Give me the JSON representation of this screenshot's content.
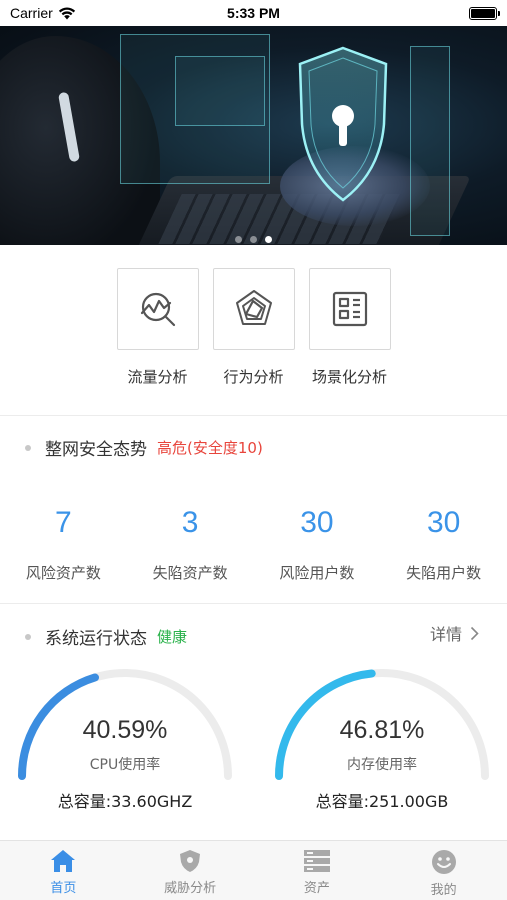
{
  "status_bar": {
    "carrier": "Carrier",
    "time": "5:33 PM"
  },
  "banner": {
    "slide_count": 3,
    "active_slide": 3
  },
  "quick_actions": [
    {
      "label": "流量分析",
      "icon": "traffic-analysis-icon"
    },
    {
      "label": "行为分析",
      "icon": "behavior-analysis-icon"
    },
    {
      "label": "场景化分析",
      "icon": "scenario-analysis-icon"
    }
  ],
  "security": {
    "title": "整网安全态势",
    "status": "高危(安全度10)",
    "status_color": "#e8453c",
    "stats": [
      {
        "value": "7",
        "label": "风险资产数"
      },
      {
        "value": "3",
        "label": "失陷资产数"
      },
      {
        "value": "30",
        "label": "风险用户数"
      },
      {
        "value": "30",
        "label": "失陷用户数"
      }
    ]
  },
  "system": {
    "title": "系统运行状态",
    "status": "健康",
    "status_color": "#2ab24b",
    "detail_label": "详情",
    "gauges": [
      {
        "value": "40.59%",
        "percent": 40.59,
        "label": "CPU使用率",
        "total": "总容量:33.60GHZ",
        "color": "#3b8de0"
      },
      {
        "value": "46.81%",
        "percent": 46.81,
        "label": "内存使用率",
        "total": "总容量:251.00GB",
        "color": "#33b9ec"
      }
    ]
  },
  "tab_bar": {
    "active": 0,
    "tabs": [
      {
        "label": "首页",
        "icon": "home-icon"
      },
      {
        "label": "威胁分析",
        "icon": "shield-icon"
      },
      {
        "label": "资产",
        "icon": "server-icon"
      },
      {
        "label": "我的",
        "icon": "smiley-face-icon"
      }
    ]
  },
  "colors": {
    "accent": "#3a8ee6",
    "stat_blue": "#3a93e8"
  }
}
